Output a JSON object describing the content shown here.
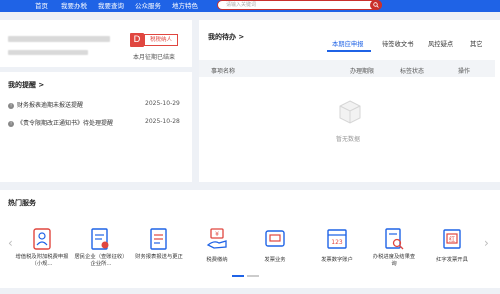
{
  "topnav": {
    "items": [
      "首页",
      "我要办税",
      "我要查询",
      "公众服务",
      "地方特色"
    ]
  },
  "search": {
    "placeholder": "请输入关键词"
  },
  "profile": {
    "badge_letter": "D",
    "taxpayer_type": "税税纳人",
    "period_text": "本月征期已结束"
  },
  "reminders": {
    "title": "我的提醒 >",
    "items": [
      {
        "text": "财务报表逾期未报送提醒",
        "date": "2025-10-29"
      },
      {
        "text": "《责令限期改正通知书》待处理提醒",
        "date": "2025-10-28"
      }
    ]
  },
  "todo": {
    "title": "我的待办 >",
    "tabs": [
      "本期应申报",
      "待签收文书",
      "风控疑点",
      "其它"
    ],
    "active_tab": "本期应申报",
    "columns": [
      "事项名称",
      "办理期限",
      "标签状态",
      "操作"
    ],
    "empty_text": "暂无数据"
  },
  "services": {
    "title": "热门服务",
    "items": [
      {
        "label": "增值税及附加税费申报（小规..."
      },
      {
        "label": "居民企业（查账征收）企业所..."
      },
      {
        "label": "财务报表报送与更正"
      },
      {
        "label": "税费缴纳"
      },
      {
        "label": "发票业务"
      },
      {
        "label": "发票数字账户"
      },
      {
        "label": "办税进度及结果查询"
      },
      {
        "label": "红字发票开具"
      }
    ]
  },
  "colors": {
    "primary": "#1f63e6",
    "danger": "#e0463f",
    "search_border": "#c9302c"
  }
}
